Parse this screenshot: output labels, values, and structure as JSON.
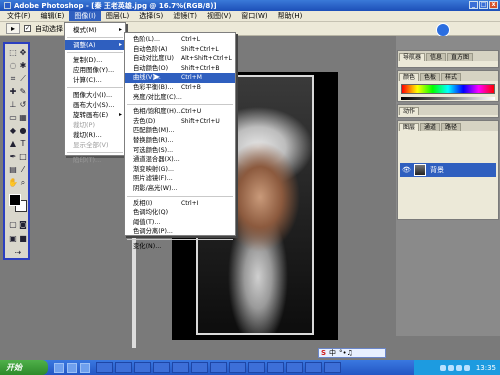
{
  "window": {
    "title": "Adobe Photoshop - [秦 王老英雄.jpg @ 16.7%(RGB/8)]",
    "buttons": [
      "_",
      "□",
      "x"
    ]
  },
  "menubar": {
    "items": [
      "文件(F)",
      "编辑(E)",
      "图像(I)",
      "图层(L)",
      "选择(S)",
      "滤镜(T)",
      "视图(V)",
      "窗口(W)",
      "帮助(H)"
    ],
    "active_index": 2
  },
  "options": {
    "tool_glyph": "▸",
    "auto_select_label": "自动选择"
  },
  "adjust_menu": {
    "items": [
      {
        "label": "模式(M)",
        "arrow": "▸"
      },
      {
        "sep": true
      },
      {
        "label": "调整(A)",
        "arrow": "▸",
        "selected": true
      },
      {
        "sep": true
      },
      {
        "label": "复制(D)..."
      },
      {
        "label": "应用图像(Y)..."
      },
      {
        "label": "计算(C)..."
      },
      {
        "sep": true
      },
      {
        "label": "图像大小(I)..."
      },
      {
        "label": "画布大小(S)..."
      },
      {
        "label": "旋转画布(E)",
        "arrow": "▸"
      },
      {
        "label": "裁切(P)",
        "disabled": true
      },
      {
        "label": "裁切(R)..."
      },
      {
        "label": "显示全部(V)",
        "disabled": true
      },
      {
        "sep": true
      },
      {
        "label": "陷印(T)...",
        "disabled": true
      }
    ]
  },
  "adjust_submenu": {
    "items": [
      {
        "label": "色阶(L)...",
        "shortcut": "Ctrl+L"
      },
      {
        "label": "自动色阶(A)",
        "shortcut": "Shift+Ctrl+L"
      },
      {
        "label": "自动对比度(U)",
        "shortcut": "Alt+Shift+Ctrl+L"
      },
      {
        "label": "自动颜色(O)",
        "shortcut": "Shift+Ctrl+B"
      },
      {
        "label": "曲线(V)...",
        "shortcut": "Ctrl+M",
        "selected": true
      },
      {
        "label": "色彩平衡(B)...",
        "shortcut": "Ctrl+B"
      },
      {
        "label": "亮度/对比度(C)..."
      },
      {
        "sep": true
      },
      {
        "label": "色相/饱和度(H)...",
        "shortcut": "Ctrl+U"
      },
      {
        "label": "去色(D)",
        "shortcut": "Shift+Ctrl+U"
      },
      {
        "label": "匹配颜色(M)..."
      },
      {
        "label": "替换颜色(R)..."
      },
      {
        "label": "可选颜色(S)..."
      },
      {
        "label": "通道混合器(X)..."
      },
      {
        "label": "渐变映射(G)..."
      },
      {
        "label": "照片滤镜(F)..."
      },
      {
        "label": "阴影/高光(W)..."
      },
      {
        "sep": true
      },
      {
        "label": "反相(I)",
        "shortcut": "Ctrl+I"
      },
      {
        "label": "色调均化(Q)"
      },
      {
        "label": "阈值(T)..."
      },
      {
        "label": "色调分离(P)..."
      },
      {
        "sep": true
      },
      {
        "label": "变化(N)..."
      }
    ]
  },
  "panels": {
    "navigator": {
      "tabs": [
        "导航器",
        "信息",
        "直方图"
      ]
    },
    "color": {
      "tabs": [
        "颜色",
        "色板",
        "样式"
      ]
    },
    "history": {
      "tabs": [
        "动作"
      ]
    },
    "layers": {
      "tabs": [
        "图层",
        "通道",
        "路径"
      ],
      "layer_name": "背景"
    }
  },
  "ime": {
    "label": "中",
    "icons": "°•♫"
  },
  "taskbar": {
    "start_label": "开始",
    "clock": "13:35"
  },
  "colors": {
    "accent": "#2f5fbf",
    "toolbox_border": "#2b3fc0",
    "taskbar": "#2356c4"
  }
}
